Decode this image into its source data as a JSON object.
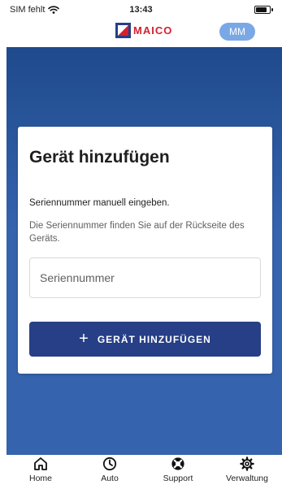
{
  "status_bar": {
    "carrier": "SIM fehlt",
    "time": "13:43",
    "battery_level": 0.85
  },
  "header": {
    "logo_text": "MAICO",
    "avatar_initials": "MM"
  },
  "colors": {
    "primary": "#263f86",
    "brand_red": "#d42030",
    "avatar": "#7aa8e6",
    "hero_top": "#1f4a8c",
    "hero_bottom": "#3563ad"
  },
  "card": {
    "title": "Gerät hinzufügen",
    "subtitle": "Seriennummer manuell eingeben.",
    "hint": "Die Seriennummer finden Sie auf der Rückseite des Geräts.",
    "serial_input": {
      "placeholder": "Seriennummer",
      "value": ""
    },
    "add_button": {
      "icon": "plus-icon",
      "label": "GERÄT HINZUFÜGEN"
    }
  },
  "bottom_nav": {
    "items": [
      {
        "icon": "home-icon",
        "label": "Home"
      },
      {
        "icon": "clock-icon",
        "label": "Auto"
      },
      {
        "icon": "lifebuoy-icon",
        "label": "Support"
      },
      {
        "icon": "gear-icon",
        "label": "Verwaltung"
      }
    ]
  }
}
